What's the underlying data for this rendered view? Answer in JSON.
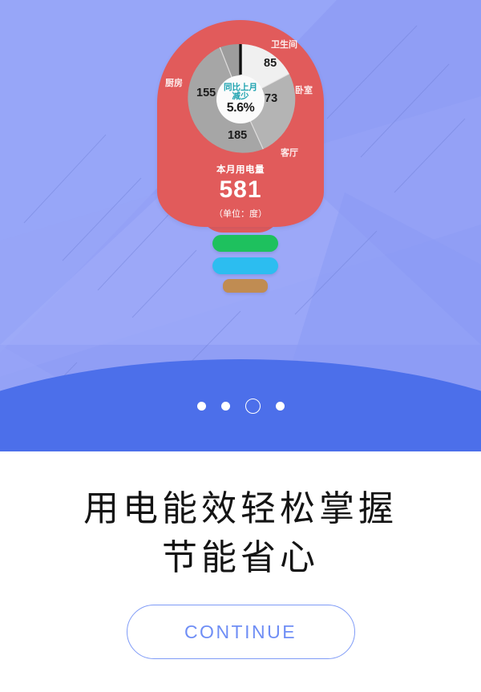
{
  "screen": {
    "name": "onboarding-energy-efficiency"
  },
  "illustration": {
    "name": "light-bulb-energy-chart"
  },
  "chart_data": {
    "type": "pie",
    "title": "本月用电量",
    "unit_label": "（单位：度）",
    "total": "581",
    "categories": [
      "卫生间",
      "卧室",
      "客厅",
      "厨房"
    ],
    "values": [
      85,
      73,
      185,
      155
    ],
    "value_labels": [
      "85",
      "73",
      "185",
      "155"
    ],
    "slice_colors": [
      "#f0f0f0",
      "#b4b4b4",
      "#a6a6a6",
      "#9d9d9d"
    ],
    "ring_color": "#e15b5b",
    "center_label": "同比上月减少",
    "center_label_line1": "同比上月",
    "center_label_line2": "减少",
    "center_value": "5.6%",
    "center_label_color": "#1ea3b0",
    "legend": "on-slice",
    "grid": false
  },
  "bulb": {
    "readout_label": "本月用电量",
    "readout_value": "581",
    "readout_unit": "（单位：度）",
    "body_color": "#e15b5b",
    "base_stripes": [
      {
        "name": "green",
        "color": "#1ec15e"
      },
      {
        "name": "blue",
        "color": "#2cbdf0"
      },
      {
        "name": "brown",
        "color": "#c08c52"
      }
    ]
  },
  "pagination": {
    "total": 4,
    "active_index": 2,
    "dots": [
      "1",
      "2",
      "3",
      "4"
    ]
  },
  "content": {
    "headline_line1": "用电能效轻松掌握",
    "headline_line2": "节能省心"
  },
  "actions": {
    "continue_label": "CONTINUE",
    "continue_border_color": "#7f9bf7",
    "continue_text_color": "#6f8ef5"
  },
  "theme": {
    "background": "#909ef5",
    "curve_color": "#4c6fea",
    "page_background": "#ffffff"
  }
}
